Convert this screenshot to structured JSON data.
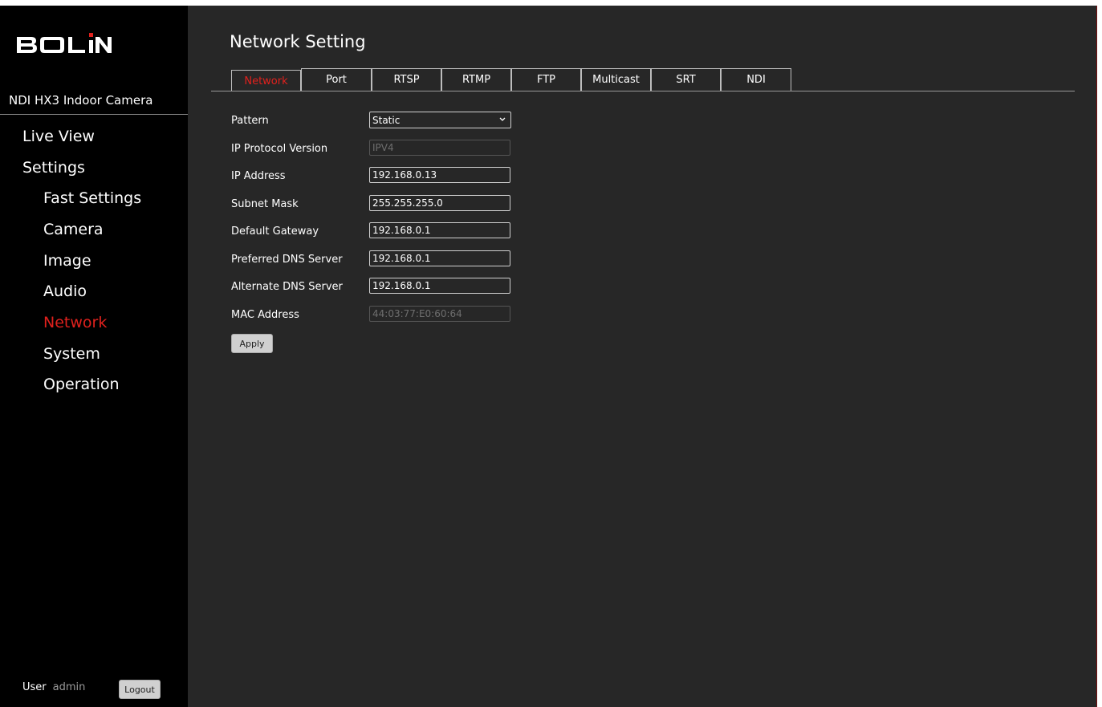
{
  "brand": {
    "logo_text": "BOLIN"
  },
  "device": {
    "name": "NDI HX3 Indoor Camera"
  },
  "sidebar": {
    "items": [
      {
        "label": "Live View"
      },
      {
        "label": "Settings"
      },
      {
        "label": "Fast Settings"
      },
      {
        "label": "Camera"
      },
      {
        "label": "Image"
      },
      {
        "label": "Audio"
      },
      {
        "label": "Network"
      },
      {
        "label": "System"
      },
      {
        "label": "Operation"
      }
    ],
    "active": "Network"
  },
  "user": {
    "label": "User",
    "name": "admin",
    "logout_label": "Logout"
  },
  "page": {
    "title": "Network Setting"
  },
  "tabs": [
    {
      "label": "Network"
    },
    {
      "label": "Port"
    },
    {
      "label": "RTSP"
    },
    {
      "label": "RTMP"
    },
    {
      "label": "FTP"
    },
    {
      "label": "Multicast"
    },
    {
      "label": "SRT"
    },
    {
      "label": "NDI"
    }
  ],
  "form": {
    "pattern": {
      "label": "Pattern",
      "value": "Static"
    },
    "ip_protocol": {
      "label": "IP Protocol Version",
      "value": "IPV4"
    },
    "ip_address": {
      "label": "IP Address",
      "value": "192.168.0.13"
    },
    "subnet_mask": {
      "label": "Subnet Mask",
      "value": "255.255.255.0"
    },
    "gateway": {
      "label": "Default Gateway",
      "value": "192.168.0.1"
    },
    "preferred_dns": {
      "label": "Preferred DNS Server",
      "value": "192.168.0.1"
    },
    "alternate_dns": {
      "label": "Alternate DNS Server",
      "value": "192.168.0.1"
    },
    "mac_address": {
      "label": "MAC Address",
      "value": "44:03:77:E0:60:64"
    },
    "apply_label": "Apply"
  },
  "colors": {
    "sidebar_bg": "#000000",
    "main_bg": "#272727",
    "accent": "#e0211d"
  }
}
